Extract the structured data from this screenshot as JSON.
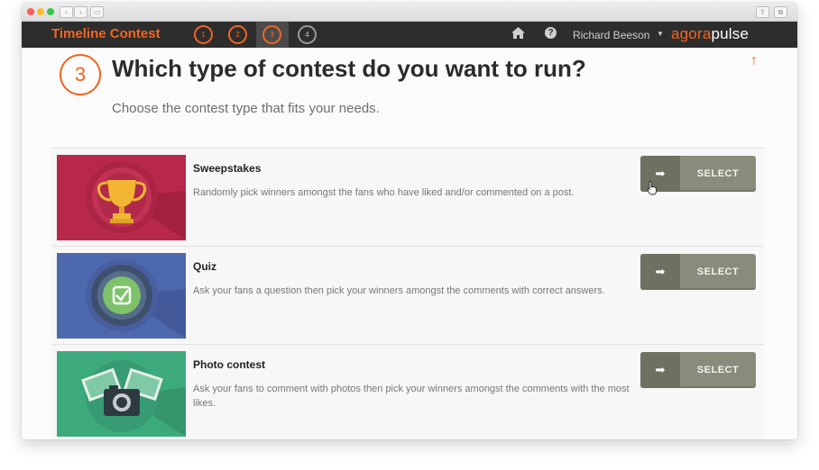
{
  "chrome": {
    "back_icon": "chevron-left-icon",
    "forward_icon": "chevron-right-icon",
    "sidebar_icon": "sidebar-icon",
    "share_icon": "share-icon",
    "tabs_icon": "tabs-icon"
  },
  "appbar": {
    "title": "Timeline Contest",
    "steps": [
      "1",
      "2",
      "3",
      "4"
    ],
    "active_step": "3",
    "home_icon": "home-icon",
    "help_icon": "help-icon",
    "user_name": "Richard Beeson",
    "brand_agora": "agora",
    "brand_pulse": "pulse"
  },
  "main": {
    "step_number": "3",
    "heading": "Which type of contest do you want to run?",
    "subheading": "Choose the contest type that fits your needs.",
    "scroll_top_icon": "arrow-up-icon"
  },
  "contests": [
    {
      "title": "Sweepstakes",
      "description": "Randomly pick winners amongst the fans who have liked and/or commented on a post.",
      "button_label": "SELECT",
      "icon": "trophy-icon",
      "color": "#b8284a"
    },
    {
      "title": "Quiz",
      "description": "Ask your fans a question then pick your winners amongst the comments with correct answers.",
      "button_label": "SELECT",
      "icon": "checkbox-icon",
      "color": "#4e68ad"
    },
    {
      "title": "Photo contest",
      "description": "Ask your fans to comment with photos then pick your winners amongst the comments with the most likes.",
      "button_label": "SELECT",
      "icon": "camera-icon",
      "color": "#3daa7d"
    }
  ],
  "colors": {
    "accent": "#f26522",
    "appbar": "#2d2d2d",
    "button": "#8b8b7c"
  }
}
